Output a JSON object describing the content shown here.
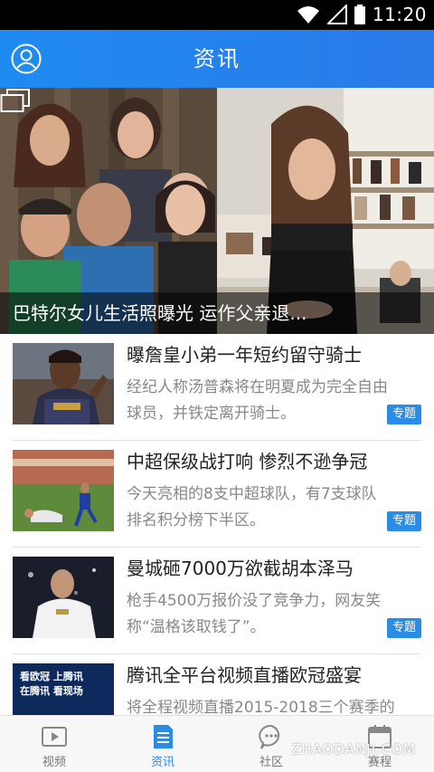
{
  "status_bar": {
    "time": "11:20"
  },
  "header": {
    "title": "资讯",
    "avatar_icon": "user-icon"
  },
  "banner": {
    "caption": "巴特尔女儿生活照曝光 运作父亲退...",
    "gallery_icon": "gallery-icon"
  },
  "news": [
    {
      "title": "曝詹皇小弟一年短约留守骑士",
      "desc": "经纪人称汤普森将在明夏成为完全自由球员，并铁定离开骑士。",
      "tag": "专题"
    },
    {
      "title": "中超保级战打响 惨烈不逊争冠",
      "desc": "今天亮相的8支中超球队，有7支球队排名积分榜下半区。",
      "tag": "专题"
    },
    {
      "title": "曼城砸7000万欲截胡本泽马",
      "desc": "枪手4500万报价没了竞争力，网友笑称“温格该取钱了”。",
      "tag": "专题"
    },
    {
      "title": "腾讯全平台视频直播欧冠盛宴",
      "desc": "将全程视频直播2015-2018三个赛季的",
      "tag": "",
      "thumb_text_1": "看欧冠 上腾讯",
      "thumb_text_2": "在腾讯 看现场"
    }
  ],
  "tabs": [
    {
      "label": "视频",
      "icon": "video-icon",
      "active": false
    },
    {
      "label": "资讯",
      "icon": "news-icon",
      "active": true
    },
    {
      "label": "社区",
      "icon": "chat-icon",
      "active": false
    },
    {
      "label": "赛程",
      "icon": "calendar-icon",
      "active": false
    }
  ],
  "watermark": "ZHAODANJI.COM",
  "colors": {
    "accent": "#2b8ce6",
    "header": "#1f8bf1"
  }
}
